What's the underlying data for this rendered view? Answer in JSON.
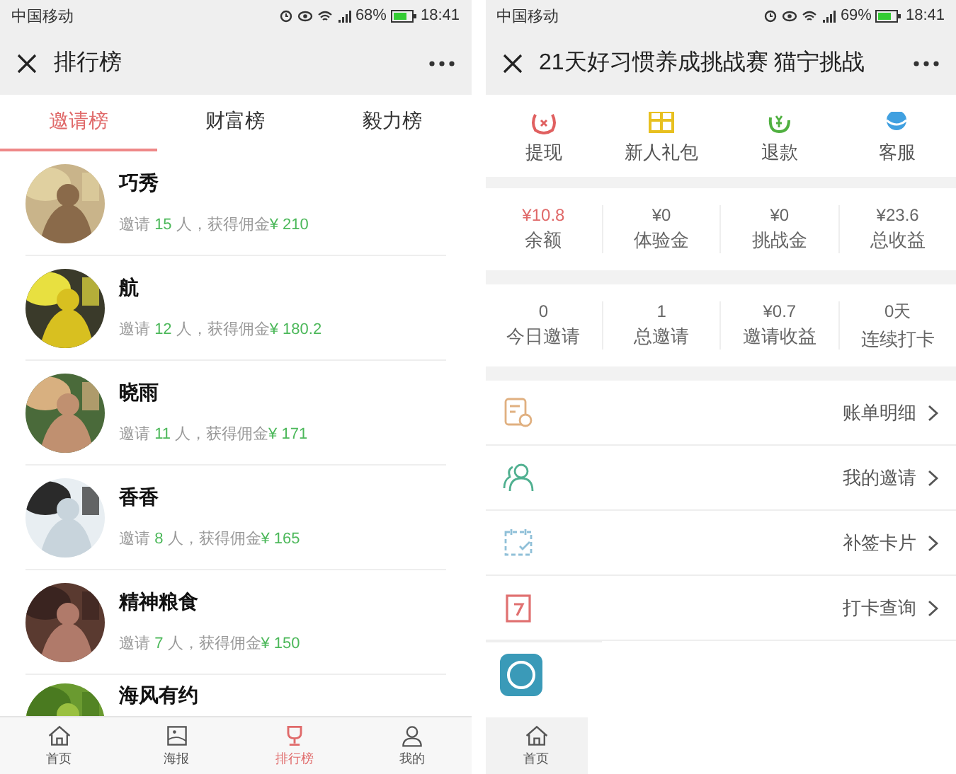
{
  "left_screen": {
    "status_bar": {
      "carrier": "中国移动",
      "battery": "68%",
      "time": "18:41"
    },
    "title": "排行榜",
    "tabs": [
      {
        "label": "邀请榜",
        "selected": true
      },
      {
        "label": "财富榜",
        "selected": false
      },
      {
        "label": "毅力榜",
        "selected": false
      }
    ],
    "rankings": [
      {
        "name": "巧秀",
        "before": "邀请",
        "count": "15",
        "middle": "人，获得佣金",
        "amount": "¥ 210"
      },
      {
        "name": "航",
        "before": "邀请",
        "count": "12",
        "middle": "人，获得佣金",
        "amount": "¥ 180.2"
      },
      {
        "name": "晓雨",
        "before": "邀请",
        "count": "11",
        "middle": "人，获得佣金",
        "amount": "¥ 171"
      },
      {
        "name": "香香",
        "before": "邀请",
        "count": "8",
        "middle": "人，获得佣金",
        "amount": "¥ 165"
      },
      {
        "name": "精神粮食",
        "before": "邀请",
        "count": "7",
        "middle": "人，获得佣金",
        "amount": "¥ 150"
      },
      {
        "name": "海风有约"
      }
    ],
    "bottom_nav": [
      {
        "label": "首页",
        "selected": false
      },
      {
        "label": "海报",
        "selected": false
      },
      {
        "label": "排行榜",
        "selected": true
      },
      {
        "label": "我的",
        "selected": false
      }
    ]
  },
  "right_screen": {
    "status_bar": {
      "carrier": "中国移动",
      "battery": "69%",
      "time": "18:41"
    },
    "title": "21天好习惯养成挑战赛 猫宁挑战",
    "shortcuts": [
      {
        "label": "提现"
      },
      {
        "label": "新人礼包"
      },
      {
        "label": "退款"
      },
      {
        "label": "客服"
      }
    ],
    "stat_rows": [
      [
        {
          "value": "¥10.8",
          "label": "余额",
          "highlighted": true
        },
        {
          "value": "¥0",
          "label": "体验金",
          "highlighted": false
        },
        {
          "value": "¥0",
          "label": "挑战金",
          "highlighted": false
        },
        {
          "value": "¥23.6",
          "label": "总收益",
          "highlighted": false
        }
      ],
      [
        {
          "value": "0",
          "label": "今日邀请",
          "highlighted": false
        },
        {
          "value": "1",
          "label": "总邀请",
          "highlighted": false
        },
        {
          "value": "¥0.7",
          "label": "邀请收益",
          "highlighted": false
        },
        {
          "value": "0天",
          "label": "连续打卡",
          "highlighted": false
        }
      ]
    ],
    "menu": [
      {
        "label": "账单明细"
      },
      {
        "label": "我的邀请"
      },
      {
        "label": "补签卡片"
      },
      {
        "label": "打卡查询"
      }
    ],
    "bottom_nav": [
      {
        "label": "首页",
        "selected": false
      }
    ]
  }
}
